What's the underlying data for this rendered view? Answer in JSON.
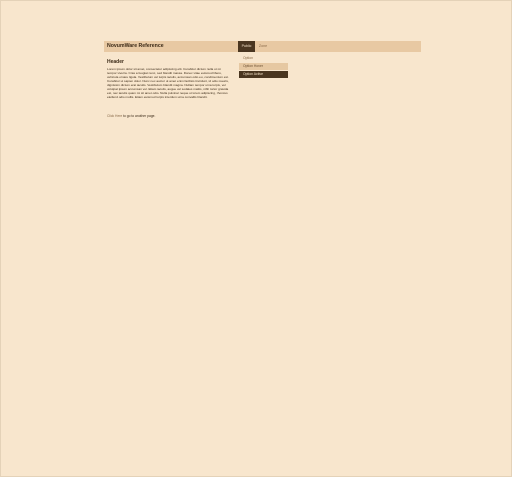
{
  "site": {
    "title": "NovumWare Reference"
  },
  "tabs": [
    {
      "label": "Public"
    },
    {
      "label": "Zone"
    }
  ],
  "content": {
    "header": "Header",
    "body": "Lorem ipsum dolor sit amet, consectetur adipiscing elit. Curabitur dictum nulla ut mi tempor viverra. Cras a feugiat nunc, sed blandit massa. Donec vitae euismod libero, vehicula ornare ligula. Vestibulum vel turpis iaculis, accumsan odio eu, condimentum est. Curabitur ut sapien dolor. Nunc nec auctor ut amet enim facilisis tincidunt, id odio mauris, dignissim dictum erat iaculis. Vestibulum blandit magna. Nullam tempor urna turpis, vel volutpat ipsum accumsan vel. Etiam iaculis, augue vel sodales mattis, nibh tortor gravida est, nec iaculis quam mi sit amet odio. Nulla pulvinar neque ut lorem adipiscing, rhoncus eleifend odio mollis. Etiam euismod turpis interdum urna convallis blandit.",
    "link_text": "Click Here",
    "link_suffix": " to go to another page."
  },
  "menu": [
    {
      "label": "Option",
      "state": "plain"
    },
    {
      "label": "Option Hover",
      "state": "hover"
    },
    {
      "label": "Option Active",
      "state": "active"
    }
  ],
  "colors": {
    "background": "#f8e6cd",
    "bar": "#e8c9a3",
    "dark": "#4a3620",
    "text": "#3b2a17",
    "muted": "#8a6b4a"
  }
}
